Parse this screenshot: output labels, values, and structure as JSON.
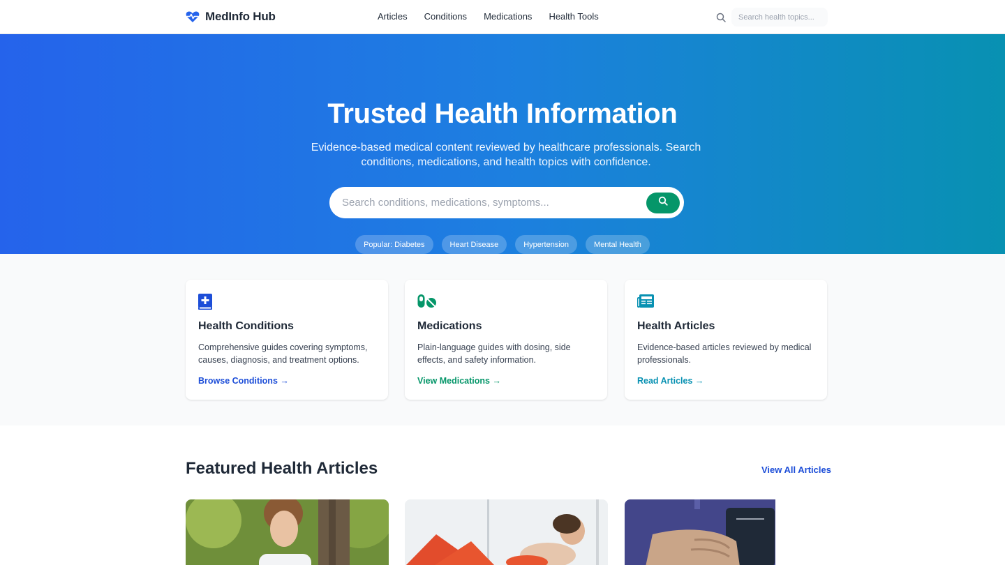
{
  "header": {
    "brand": "MedInfo Hub",
    "nav": [
      "Articles",
      "Conditions",
      "Medications",
      "Health Tools"
    ],
    "search_placeholder": "Search health topics..."
  },
  "hero": {
    "title": "Trusted Health Information",
    "subtitle": "Evidence-based medical content reviewed by healthcare professionals. Search conditions, medications, and health topics with confidence.",
    "search_placeholder": "Search conditions, medications, symptoms...",
    "chips": [
      "Popular: Diabetes",
      "Heart Disease",
      "Hypertension",
      "Mental Health"
    ]
  },
  "cards": [
    {
      "icon": "book-medical-icon",
      "title": "Health Conditions",
      "text": "Comprehensive guides covering symptoms, causes, diagnosis, and treatment options.",
      "link": "Browse Conditions →",
      "color": "#1d4ed8"
    },
    {
      "icon": "pills-icon",
      "title": "Medications",
      "text": "Plain-language guides with dosing, side effects, and safety information.",
      "link": "View Medications →",
      "color": "#059669"
    },
    {
      "icon": "newspaper-icon",
      "title": "Health Articles",
      "text": "Evidence-based articles reviewed by medical professionals.",
      "link": "Read Articles →",
      "color": "#0891b2"
    }
  ],
  "featured": {
    "title": "Featured Health Articles",
    "view_all": "View All Articles"
  },
  "colors": {
    "primary": "#2563eb",
    "accent_green": "#059669",
    "accent_teal": "#0891b2"
  }
}
